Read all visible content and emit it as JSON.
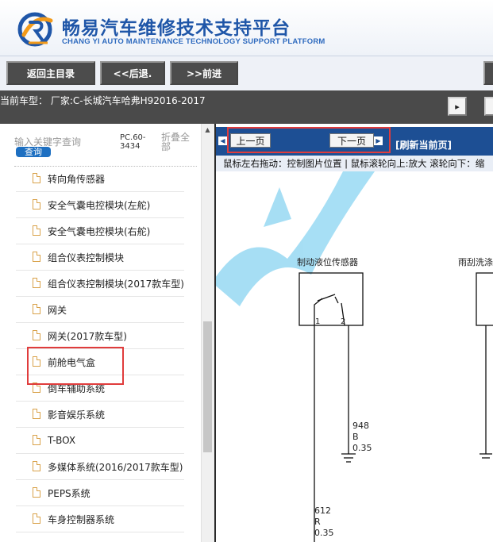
{
  "header": {
    "title_cn": "畅易汽车维修技术支持平台",
    "title_en": "CHANG YI AUTO MAINTENANCE TECHNOLOGY SUPPORT PLATFORM",
    "colors": {
      "brand_blue": "#1f56a8",
      "accent_orange": "#f29a1a"
    }
  },
  "nav": {
    "home_label": "返回主目录",
    "back_label": "<<后退.",
    "forward_label": ">>前进"
  },
  "vehicle_info": "当前车型：  厂家:C-长城汽车哈弗H92016-2017",
  "search": {
    "placeholder": "输入关键字查询",
    "button_label": "查询",
    "code": "PC.60-3434",
    "fold_label": "折叠全部"
  },
  "sidebar_items": [
    "转向角传感器",
    "安全气囊电控模块(左舵)",
    "安全气囊电控模块(右舵)",
    "组合仪表控制模块",
    "组合仪表控制模块(2017款车型)",
    "网关",
    "网关(2017款车型)",
    "前舱电气盒",
    "倒车辅助系统",
    "影音娱乐系统",
    "T-BOX",
    "多媒体系统(2016/2017款车型)",
    "PEPS系统",
    "车身控制器系统"
  ],
  "pager": {
    "prev_label": "上一页",
    "next_label": "下一页",
    "refresh_label": "[刷新当前页]"
  },
  "hint_text": "鼠标左右拖动：控制图片位置 | 鼠标滚轮向上:放大  滚轮向下：缩",
  "diagram": {
    "component_1": "制动液位传感器",
    "component_2": "雨刮洗涤",
    "pin_1": "1",
    "pin_2": "2",
    "wire_a_code": "948",
    "wire_a_color": "B",
    "wire_a_size": "0.35",
    "wire_b_code": "612",
    "wire_b_color": "R",
    "wire_b_size": "0.35"
  }
}
